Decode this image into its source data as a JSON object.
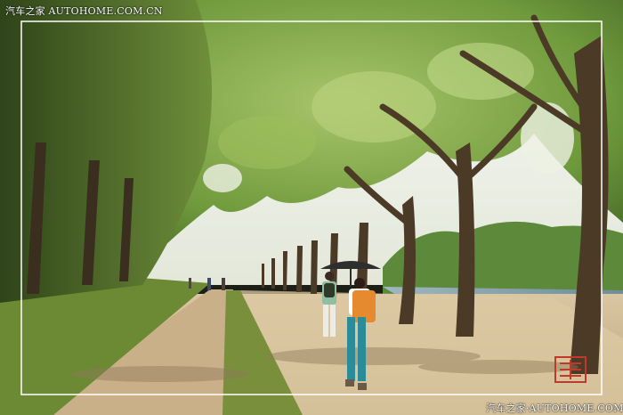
{
  "watermark": {
    "top": "汽车之家  AUTOHOME.COM.CN",
    "bottom": "汽车之家·AUTOHOME.COM.CN",
    "stamp_color": "#c0392b"
  },
  "scene": {
    "sky_color": "#f2f4ee",
    "canopy_color": "#6f9a3c",
    "path_color": "#cdb48c",
    "frame_color": "#ffffff"
  }
}
